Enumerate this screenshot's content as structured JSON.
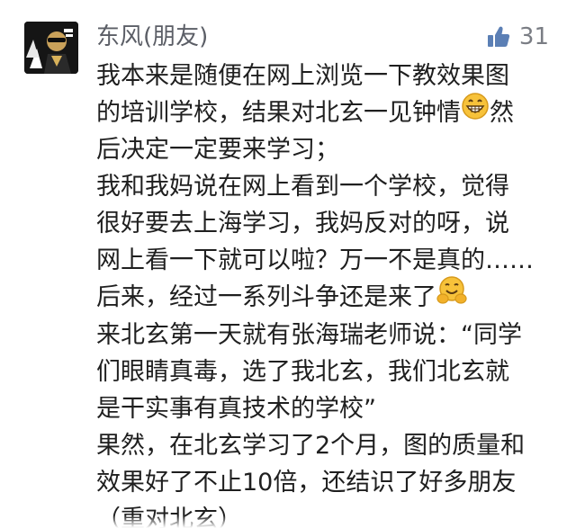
{
  "comment": {
    "username": "东风(朋友)",
    "like_count": "31",
    "lines": [
      "我本来是随便在网上浏览一下教效果图",
      "的培训学校，结果对北玄一见钟情",
      "然",
      "后决定一定要来学习；",
      "我和我妈说在网上看到一个学校，觉得",
      "很好要去上海学习，我妈反对的呀，说",
      "网上看一下就可以啦？万一不是真的……",
      "后来，经过一系列斗争还是来了",
      "来北玄第一天就有张海瑞老师说：“同学",
      "们眼睛真毒，选了我北玄，我们北玄就",
      "是干实事有真技术的学校”",
      "果然，在北玄学习了2个月，图的质量和",
      "效果好了不止10倍，还结识了好多朋友",
      "（重对北玄）"
    ]
  },
  "colors": {
    "like_icon": "#5b7fb5",
    "username": "#5b5e66",
    "text": "#1f1f1f",
    "emoji_face": "#f7c23a"
  }
}
